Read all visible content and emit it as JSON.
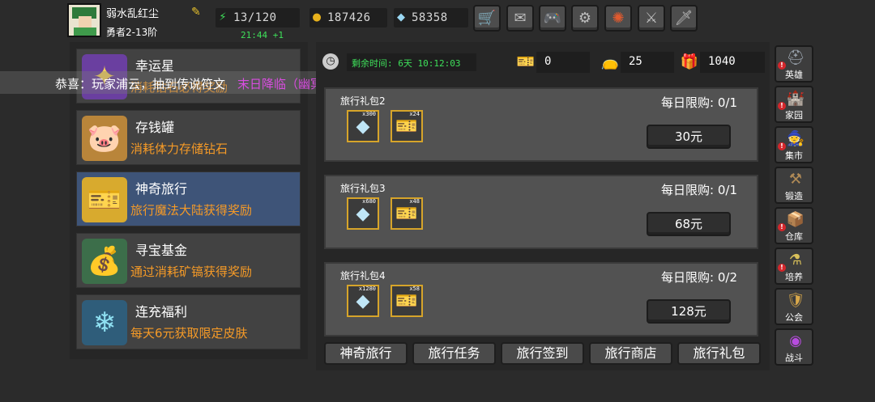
{
  "player": {
    "name": "弱水乱红尘",
    "rank": "勇者2-13阶"
  },
  "resources": {
    "stamina": "13/120",
    "gold": "187426",
    "diamonds": "58358",
    "regen_timer": "21:44 +1"
  },
  "top_buttons": [
    "shop-icon",
    "mail-icon",
    "gamepad-icon",
    "gear-icon",
    "wheel-icon",
    "weapon-icon",
    "sword-icon"
  ],
  "marquee": {
    "part1": "恭喜：玩家浦云，抽到传说符文",
    "part2": "末日降临（幽冥术士）"
  },
  "left_menu": [
    {
      "title": "幸运星",
      "desc": "消耗钻石必得奖励",
      "icon": "star-icon"
    },
    {
      "title": "存钱罐",
      "desc": "消耗体力存储钻石",
      "icon": "piggy-bank-icon"
    },
    {
      "title": "神奇旅行",
      "desc": "旅行魔法大陆获得奖励",
      "icon": "ticket-icon"
    },
    {
      "title": "寻宝基金",
      "desc": "通过消耗矿镐获得奖励",
      "icon": "treasure-bag-icon"
    },
    {
      "title": "连充福利",
      "desc": "每天6元获取限定皮肤",
      "icon": "crystal-icon"
    }
  ],
  "event": {
    "remaining_label": "剩余时间: 6天 10:12:03",
    "tickets": "0",
    "bags": "25",
    "chests": "1040"
  },
  "packs": [
    {
      "name": "旅行礼包2",
      "limit": "每日限购: 0/1",
      "price": "30元",
      "items": [
        {
          "count": "x300",
          "icon": "diamond-icon"
        },
        {
          "count": "x24",
          "icon": "ticket-icon"
        }
      ]
    },
    {
      "name": "旅行礼包3",
      "limit": "每日限购: 0/1",
      "price": "68元",
      "items": [
        {
          "count": "x680",
          "icon": "diamond-icon"
        },
        {
          "count": "x48",
          "icon": "ticket-icon"
        }
      ]
    },
    {
      "name": "旅行礼包4",
      "limit": "每日限购: 0/2",
      "price": "128元",
      "items": [
        {
          "count": "x1280",
          "icon": "diamond-icon"
        },
        {
          "count": "x58",
          "icon": "ticket-icon"
        }
      ]
    }
  ],
  "tabs": [
    "神奇旅行",
    "旅行任务",
    "旅行签到",
    "旅行商店",
    "旅行礼包"
  ],
  "side_nav": [
    {
      "label": "英雄",
      "icon": "helmet-icon",
      "badge": true
    },
    {
      "label": "家园",
      "icon": "castle-icon",
      "badge": true
    },
    {
      "label": "集市",
      "icon": "merchant-icon",
      "badge": true
    },
    {
      "label": "锻造",
      "icon": "anvil-icon",
      "badge": false
    },
    {
      "label": "仓库",
      "icon": "storage-icon",
      "badge": true
    },
    {
      "label": "培养",
      "icon": "potion-icon",
      "badge": true
    },
    {
      "label": "公会",
      "icon": "guild-icon",
      "badge": false
    },
    {
      "label": "战斗",
      "icon": "portal-icon",
      "badge": false
    }
  ],
  "colors": {
    "accent_orange": "#f59a27",
    "timer_green": "#3ee05a",
    "active_card": "#3e5478",
    "marquee_purple": "#d94de0"
  }
}
